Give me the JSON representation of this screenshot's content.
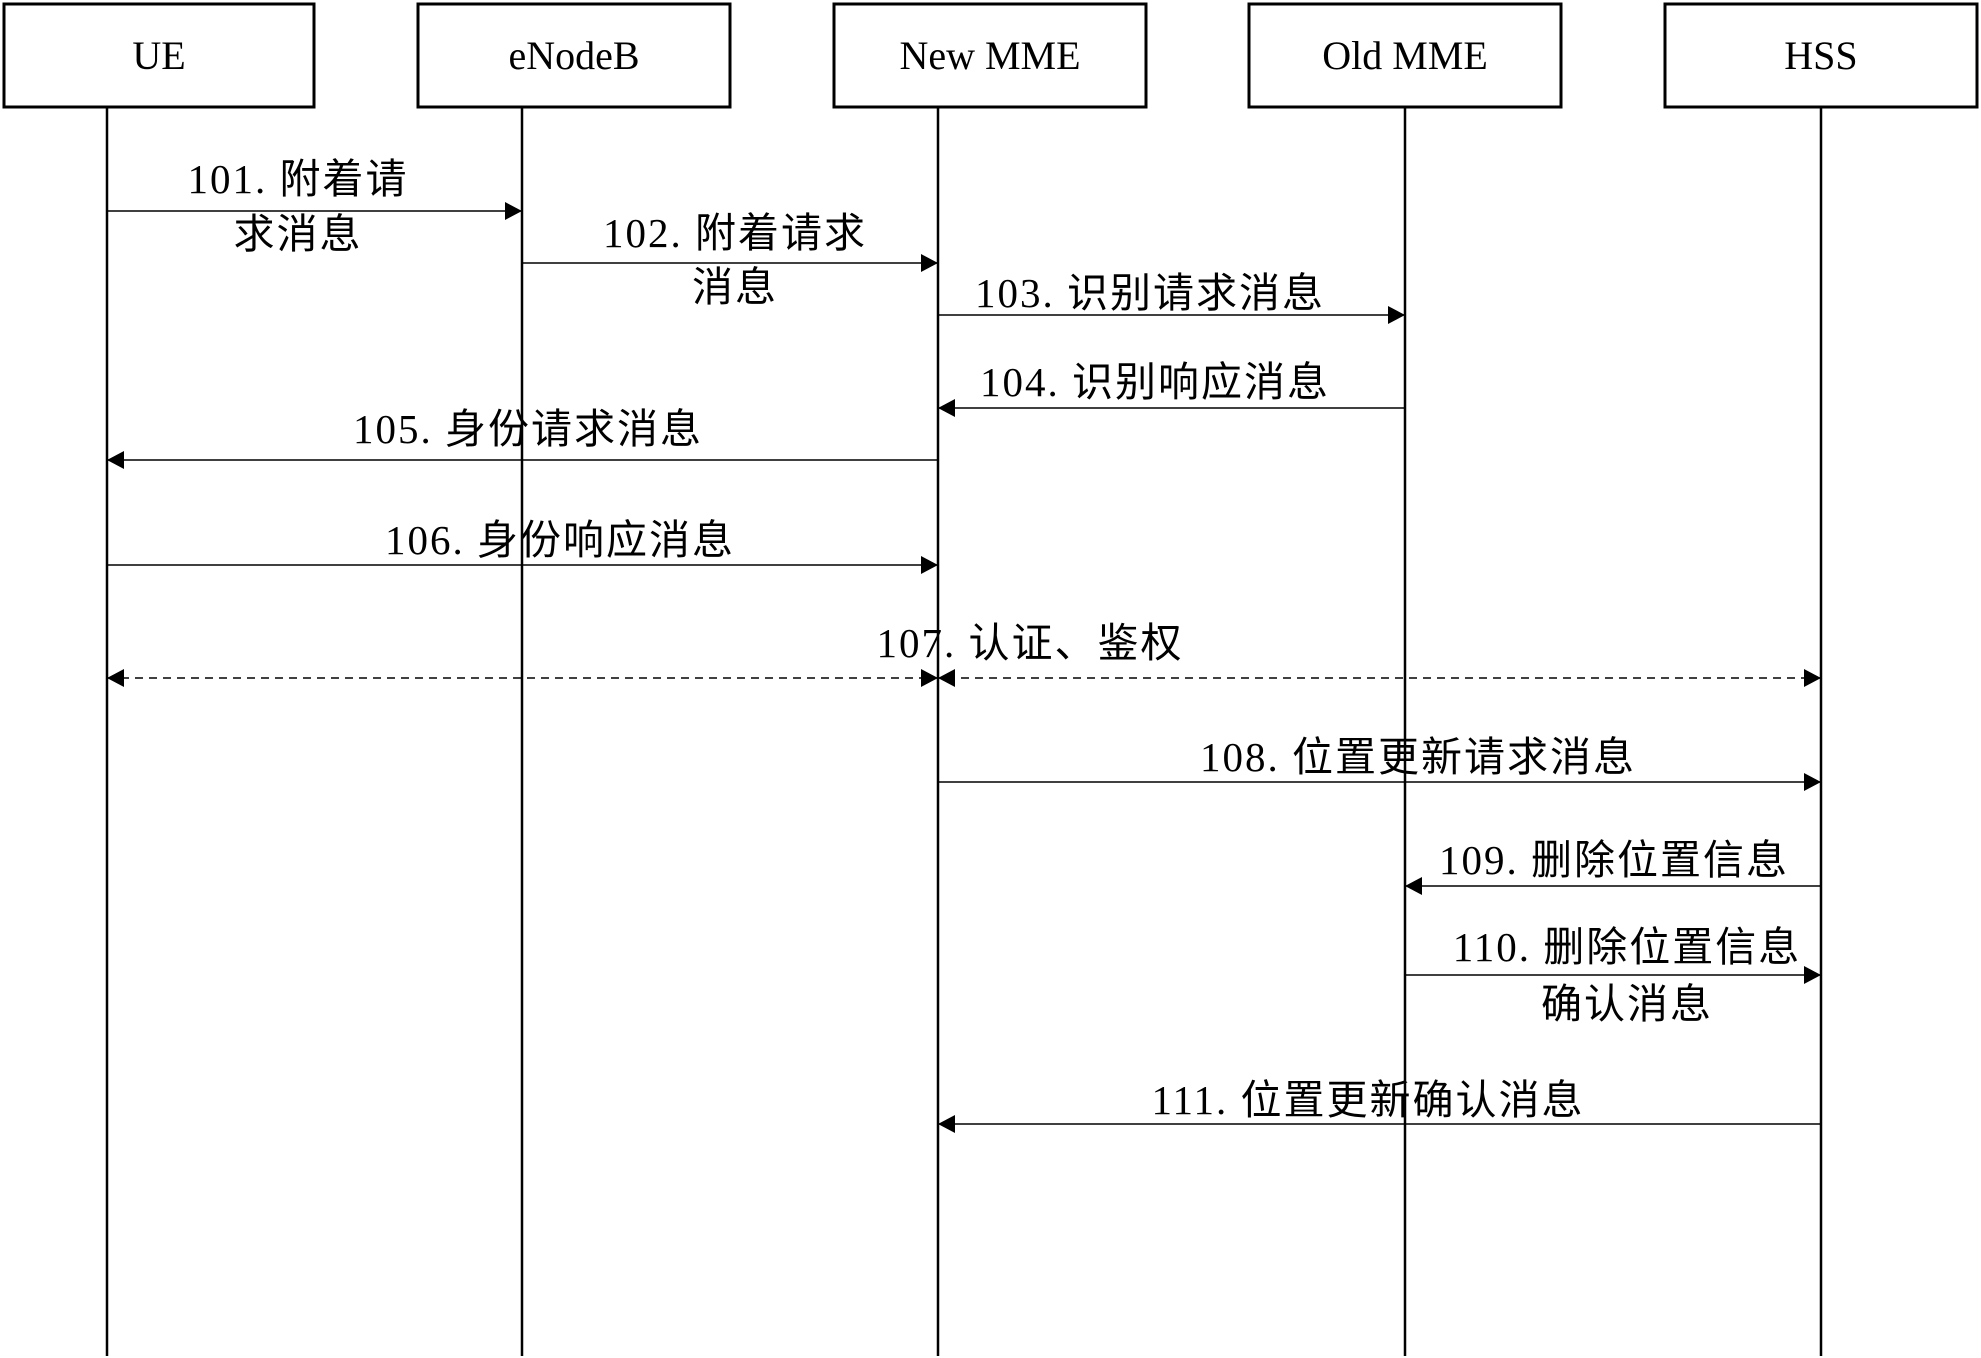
{
  "diagram": {
    "type": "sequence",
    "entities": [
      {
        "id": "ue",
        "label": "UE"
      },
      {
        "id": "enodeb",
        "label": "eNodeB"
      },
      {
        "id": "new-mme",
        "label": "New MME"
      },
      {
        "id": "old-mme",
        "label": "Old MME"
      },
      {
        "id": "hss",
        "label": "HSS"
      }
    ],
    "messages": [
      {
        "step": "101",
        "from": "ue",
        "to": "enodeb",
        "lines": [
          "101. 附着请",
          "求消息"
        ],
        "style": "solid"
      },
      {
        "step": "102",
        "from": "enodeb",
        "to": "new-mme",
        "lines": [
          "102. 附着请求",
          "消息"
        ],
        "style": "solid"
      },
      {
        "step": "103",
        "from": "new-mme",
        "to": "old-mme",
        "lines": [
          "103. 识别请求消息"
        ],
        "style": "solid"
      },
      {
        "step": "104",
        "from": "old-mme",
        "to": "new-mme",
        "lines": [
          "104. 识别响应消息"
        ],
        "style": "solid"
      },
      {
        "step": "105",
        "from": "new-mme",
        "to": "ue",
        "lines": [
          "105. 身份请求消息"
        ],
        "style": "solid"
      },
      {
        "step": "106",
        "from": "ue",
        "to": "new-mme",
        "lines": [
          "106. 身份响应消息"
        ],
        "style": "solid"
      },
      {
        "step": "107",
        "from": "ue",
        "to": "hss",
        "via": "new-mme",
        "lines": [
          "107. 认证、鉴权"
        ],
        "style": "dashed-bidirectional"
      },
      {
        "step": "108",
        "from": "new-mme",
        "to": "hss",
        "lines": [
          "108. 位置更新请求消息"
        ],
        "style": "solid"
      },
      {
        "step": "109",
        "from": "hss",
        "to": "old-mme",
        "lines": [
          "109. 删除位置信息"
        ],
        "style": "solid"
      },
      {
        "step": "110",
        "from": "old-mme",
        "to": "hss",
        "lines": [
          "110. 删除位置信息",
          "确认消息"
        ],
        "style": "solid"
      },
      {
        "step": "111",
        "from": "hss",
        "to": "new-mme",
        "lines": [
          "111. 位置更新确认消息"
        ],
        "style": "solid"
      }
    ]
  }
}
